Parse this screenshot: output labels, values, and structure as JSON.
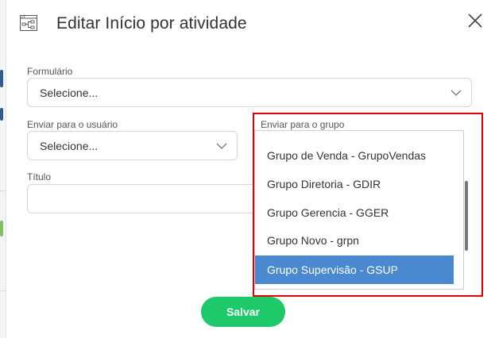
{
  "modal": {
    "title": "Editar Início por atividade",
    "icon": "workflow-diagram-icon",
    "close_icon": "close-icon"
  },
  "form": {
    "formulario": {
      "label": "Formulário",
      "value": "Selecione..."
    },
    "enviar_usuario": {
      "label": "Enviar para o usuário",
      "value": "Selecione..."
    },
    "enviar_grupo": {
      "label": "Enviar para o grupo",
      "options": [
        "Grupo de Venda - GrupoVendas",
        "Grupo Diretoria - GDIR",
        "Grupo Gerencia - GGER",
        "Grupo Novo - grpn",
        "Grupo Supervisão - GSUP"
      ],
      "selected": "Grupo Supervisão - GSUP"
    },
    "titulo": {
      "label": "Título",
      "value": ""
    }
  },
  "actions": {
    "save_label": "Salvar"
  },
  "colors": {
    "accent_green": "#1ec96a",
    "selected_blue": "#4a89cf",
    "highlight_red": "#e00000"
  }
}
